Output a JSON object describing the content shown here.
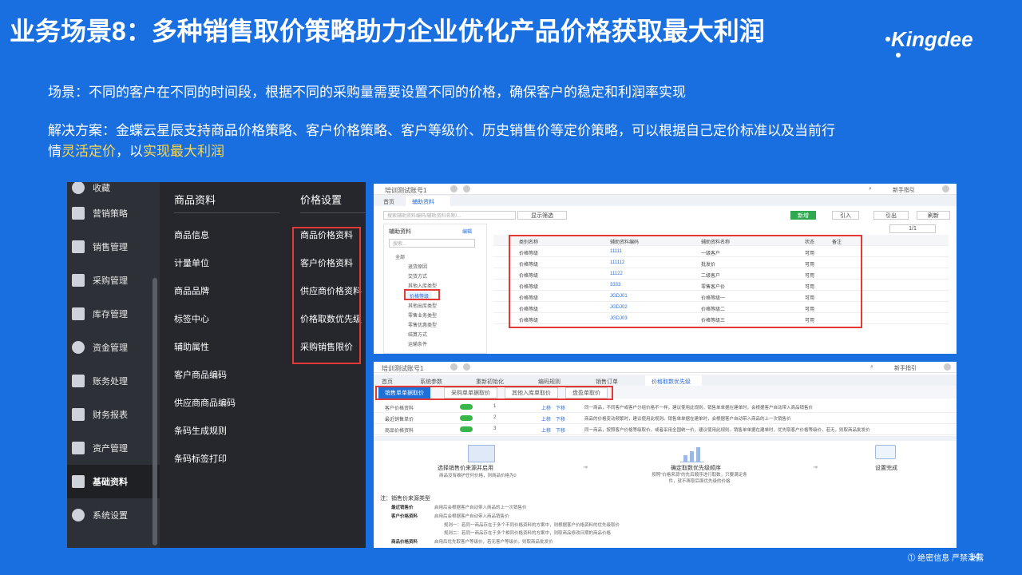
{
  "slide": {
    "title": "业务场景8：多种销售取价策略助力企业优化产品价格获取最大利润",
    "logo": "Kingdee",
    "scene_line": "场景：不同的客户在不同的时间段，根据不同的采购量需要设置不同的价格，确保客户的稳定和利润率实现",
    "solution_line1": "解决方案：金蝶云星辰支持商品价格策略、客户价格策略、客户等级价、历史销售价等定价策略，可以根据自己定价标准以及当前行",
    "solution_line2_pre": "情",
    "solution_line2_hl1": "灵活定价",
    "solution_line2_mid": "，以",
    "solution_line2_hl2": "实现最大利润",
    "footer": "⓵ 绝密信息 严禁泄露",
    "page_no": "14",
    "highlight_color": "#ffd84a",
    "bg_color": "#1a6fe0"
  },
  "menu": {
    "col1": [
      {
        "label": "收藏",
        "icon": "star-icon"
      },
      {
        "label": "营销策略",
        "icon": "tag-icon"
      },
      {
        "label": "销售管理",
        "icon": "bar-chart-icon"
      },
      {
        "label": "采购管理",
        "icon": "cart-icon"
      },
      {
        "label": "库存管理",
        "icon": "box-icon"
      },
      {
        "label": "资金管理",
        "icon": "money-icon"
      },
      {
        "label": "账务处理",
        "icon": "ledger-icon"
      },
      {
        "label": "财务报表",
        "icon": "report-icon"
      },
      {
        "label": "资产管理",
        "icon": "asset-icon"
      },
      {
        "label": "基础资料",
        "icon": "layers-icon"
      },
      {
        "label": "系统设置",
        "icon": "gear-icon"
      }
    ],
    "col2_header": "商品资料",
    "col2": [
      "商品信息",
      "计量单位",
      "商品品牌",
      "标签中心",
      "辅助属性",
      "客户商品编码",
      "供应商商品编码",
      "条码生成规则",
      "条码标签打印"
    ],
    "col3_header": "价格设置",
    "col3": [
      "商品价格资料",
      "客户价格资料",
      "供应商价格资料",
      "价格取数优先级",
      "采购销售限价"
    ]
  },
  "shot1": {
    "account": "培训测试账号1",
    "guide": "新手指引",
    "tab_home": "首页",
    "tab_aux": "辅助资料",
    "search_placeholder": "搜索辅助资料编码/辅助资料名称/...",
    "filter": "显示筛选",
    "btn_new": "新增",
    "btn_import": "引入",
    "btn_export": "引出",
    "btn_refresh": "刷新",
    "pager": "1/1",
    "tree_title": "辅助资料",
    "tree_edit": "编辑",
    "tree_search": "搜索...",
    "tree_items": [
      "全部",
      "退货原因",
      "交货方式",
      "其他入库类型",
      "价格等级",
      "其他出库类型",
      "零售业务类型",
      "零售优惠类型",
      "结算方式",
      "运输条件"
    ],
    "columns": [
      "类别名称",
      "辅助资料编码",
      "辅助资料名称",
      "状态",
      "备注"
    ],
    "rows": [
      {
        "cat": "价格等级",
        "code": "11111",
        "name": "一级客户",
        "status": "可用"
      },
      {
        "cat": "价格等级",
        "code": "111112",
        "name": "批发价",
        "status": "可用"
      },
      {
        "cat": "价格等级",
        "code": "11122",
        "name": "二级客户",
        "status": "可用"
      },
      {
        "cat": "价格等级",
        "code": "3333",
        "name": "零售客户价",
        "status": "可用"
      },
      {
        "cat": "价格等级",
        "code": "JGDJ01",
        "name": "价格等级一",
        "status": "可用"
      },
      {
        "cat": "价格等级",
        "code": "JGDJ02",
        "name": "价格等级二",
        "status": "可用"
      },
      {
        "cat": "价格等级",
        "code": "JGDJ03",
        "name": "价格等级三",
        "status": "可用"
      }
    ]
  },
  "shot2": {
    "account": "培训测试账号1",
    "guide": "新手指引",
    "tabs": [
      "首页",
      "系统参数",
      "重新初始化",
      "编码规则",
      "销售订单",
      "价格取数优先级"
    ],
    "subtabs": [
      "销售单单据取价",
      "采购单单据取价",
      "其他入库单取价",
      "盘盈单取价"
    ],
    "rows": [
      {
        "name": "客户价格资料",
        "idx": "1",
        "up": "上移",
        "down": "下移",
        "desc": "同一商品，不同客户或客户分组价格不一样，建议使用此规则。销售单单据在建单时，会根据客户自动带入商品销售价"
      },
      {
        "name": "最近销售单价",
        "idx": "2",
        "up": "上移",
        "down": "下移",
        "desc": "商品的价格变动频繁时，建议使用此规则。销售单单据在建单时，会根据客户自动带入商品的上一次销售价"
      },
      {
        "name": "商品价格资料",
        "idx": "3",
        "up": "上移",
        "down": "下移",
        "desc": "同一商品，按照客户价格等级取价，或者采用全国统一价，建议使用此规则。销售单单据在建单时，优先取客户价格等级价，若无，则取商品批发价"
      }
    ],
    "flow": [
      {
        "title": "选择销售价来源并启用",
        "sub": "商品没有维护任何价格，则商品价格为0"
      },
      {
        "title": "确定取数优先级顺序",
        "sub": "按照\"价格来源\"的先后顺序进行取数，只要满足条件，就不再取后面优先级的价格"
      },
      {
        "title": "设置完成",
        "sub": ""
      }
    ],
    "notes_title": "注：销售价来源类型",
    "notes": [
      {
        "k": "最近销售价",
        "v": "启用后会根据客户自动带入商品的上一次销售价"
      },
      {
        "k": "客户价格资料",
        "v": "启用后会根据客户自动带入商品销售价"
      },
      {
        "k": "",
        "v": "规则一：若同一商品存在于多个不同价格资料的方案中，则根据客户价格资料的优先级取价"
      },
      {
        "k": "",
        "v": "规则二：若同一商品存在于多个相同价格资料的方案中，则取商品修改日期的商品价格"
      },
      {
        "k": "商品价格资料",
        "v": "启用后优先取客户等级价，若无客户等级价，则取商品批发价"
      }
    ]
  }
}
